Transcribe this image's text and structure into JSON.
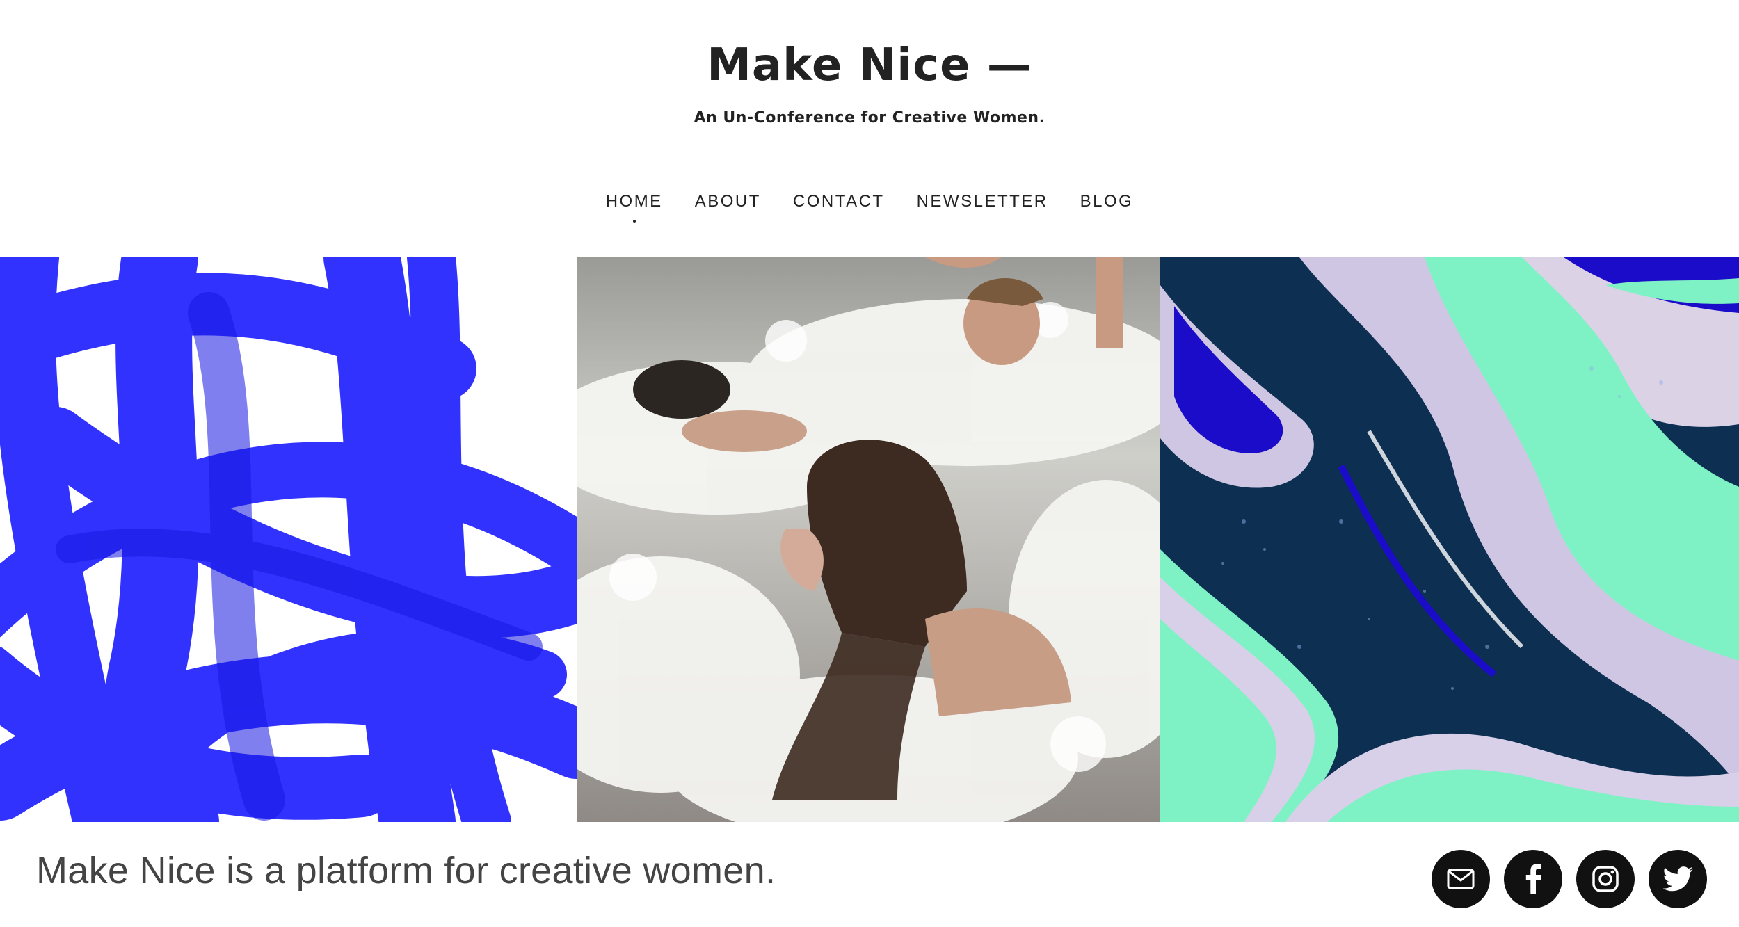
{
  "header": {
    "title": "Make Nice —",
    "tagline": "An Un-Conference for Creative Women."
  },
  "nav": {
    "items": [
      {
        "label": "HOME",
        "active": true
      },
      {
        "label": "ABOUT",
        "active": false
      },
      {
        "label": "CONTACT",
        "active": false
      },
      {
        "label": "NEWSLETTER",
        "active": false
      },
      {
        "label": "BLOG",
        "active": false
      }
    ]
  },
  "hero": {
    "images": [
      {
        "name": "blue-brushstroke-image"
      },
      {
        "name": "swimmers-waves-image"
      },
      {
        "name": "marble-glitter-image"
      }
    ]
  },
  "footer": {
    "intro": "Make Nice is a platform for creative women.",
    "social": [
      {
        "icon": "mail-icon"
      },
      {
        "icon": "facebook-icon"
      },
      {
        "icon": "instagram-icon"
      },
      {
        "icon": "twitter-icon"
      }
    ]
  },
  "colors": {
    "text": "#222222",
    "social_bg": "#111111",
    "brush_blue": "#1a1aff",
    "marble_mint": "#7ef2c4",
    "marble_navy": "#0b2a4a"
  }
}
